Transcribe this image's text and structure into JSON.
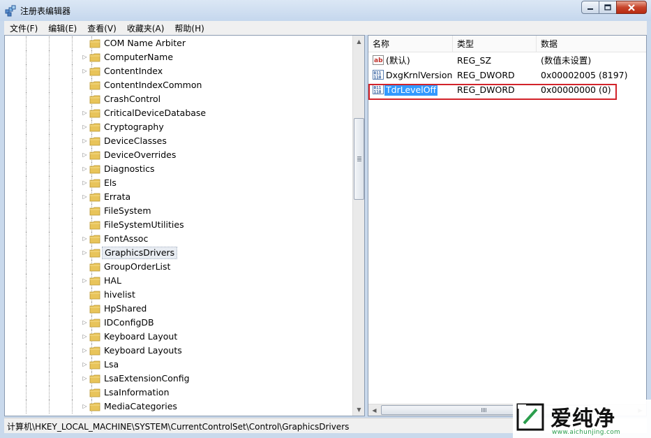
{
  "window": {
    "title": "注册表编辑器"
  },
  "menu": [
    "文件(F)",
    "编辑(E)",
    "查看(V)",
    "收藏夹(A)",
    "帮助(H)"
  ],
  "tree": [
    {
      "name": "COM Name Arbiter",
      "expandable": false
    },
    {
      "name": "ComputerName",
      "expandable": true
    },
    {
      "name": "ContentIndex",
      "expandable": true
    },
    {
      "name": "ContentIndexCommon",
      "expandable": false
    },
    {
      "name": "CrashControl",
      "expandable": false
    },
    {
      "name": "CriticalDeviceDatabase",
      "expandable": true
    },
    {
      "name": "Cryptography",
      "expandable": true
    },
    {
      "name": "DeviceClasses",
      "expandable": true
    },
    {
      "name": "DeviceOverrides",
      "expandable": true
    },
    {
      "name": "Diagnostics",
      "expandable": true
    },
    {
      "name": "Els",
      "expandable": true
    },
    {
      "name": "Errata",
      "expandable": true
    },
    {
      "name": "FileSystem",
      "expandable": false
    },
    {
      "name": "FileSystemUtilities",
      "expandable": false
    },
    {
      "name": "FontAssoc",
      "expandable": true
    },
    {
      "name": "GraphicsDrivers",
      "expandable": true,
      "selected": true
    },
    {
      "name": "GroupOrderList",
      "expandable": false
    },
    {
      "name": "HAL",
      "expandable": true
    },
    {
      "name": "hivelist",
      "expandable": false
    },
    {
      "name": "HpShared",
      "expandable": false
    },
    {
      "name": "IDConfigDB",
      "expandable": true
    },
    {
      "name": "Keyboard Layout",
      "expandable": true
    },
    {
      "name": "Keyboard Layouts",
      "expandable": true
    },
    {
      "name": "Lsa",
      "expandable": true
    },
    {
      "name": "LsaExtensionConfig",
      "expandable": true
    },
    {
      "name": "LsaInformation",
      "expandable": false
    },
    {
      "name": "MediaCategories",
      "expandable": true
    }
  ],
  "values_pane": {
    "columns": [
      "名称",
      "类型",
      "数据"
    ],
    "rows": [
      {
        "icon": "string-value-icon",
        "name": "(默认)",
        "type": "REG_SZ",
        "data": "(数值未设置)"
      },
      {
        "icon": "dword-value-icon",
        "name": "DxgKrnlVersion",
        "type": "REG_DWORD",
        "data": "0x00002005 (8197)"
      },
      {
        "icon": "dword-value-icon",
        "name": "TdrLevelOff",
        "type": "REG_DWORD",
        "data": "0x00000000 (0)",
        "selected": true,
        "highlighted": true
      }
    ]
  },
  "status": {
    "path": "计算机\\HKEY_LOCAL_MACHINE\\SYSTEM\\CurrentControlSet\\Control\\GraphicsDrivers"
  },
  "watermark": {
    "text": "爱纯净",
    "url": "www.aichunjing.com"
  },
  "colors": {
    "selection": "#3399ff",
    "highlight_box": "#d2232a",
    "folder": "#e8c45a"
  }
}
